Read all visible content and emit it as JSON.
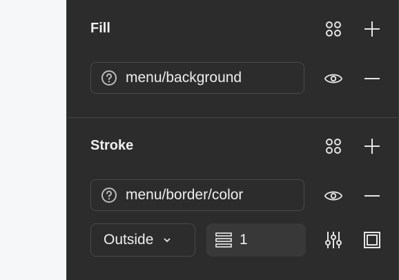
{
  "fill": {
    "title": "Fill",
    "style_name": "menu/background"
  },
  "stroke": {
    "title": "Stroke",
    "style_name": "menu/border/color",
    "position": "Outside",
    "weight": "1"
  },
  "icons": {
    "styles": "styles-grid-icon",
    "add": "plus-icon",
    "visibility": "eye-icon",
    "remove": "minus-icon",
    "detached": "question-circle-icon",
    "dropdown": "chevron-down-icon",
    "stroke_weight": "stroke-weight-icon",
    "advanced": "sliders-icon",
    "frame": "stroke-frame-icon"
  },
  "colors": {
    "panel_bg": "#2c2c2c",
    "canvas_bg": "#f6f7f9",
    "text": "#eeeeee",
    "border": "#4a4a4a"
  }
}
